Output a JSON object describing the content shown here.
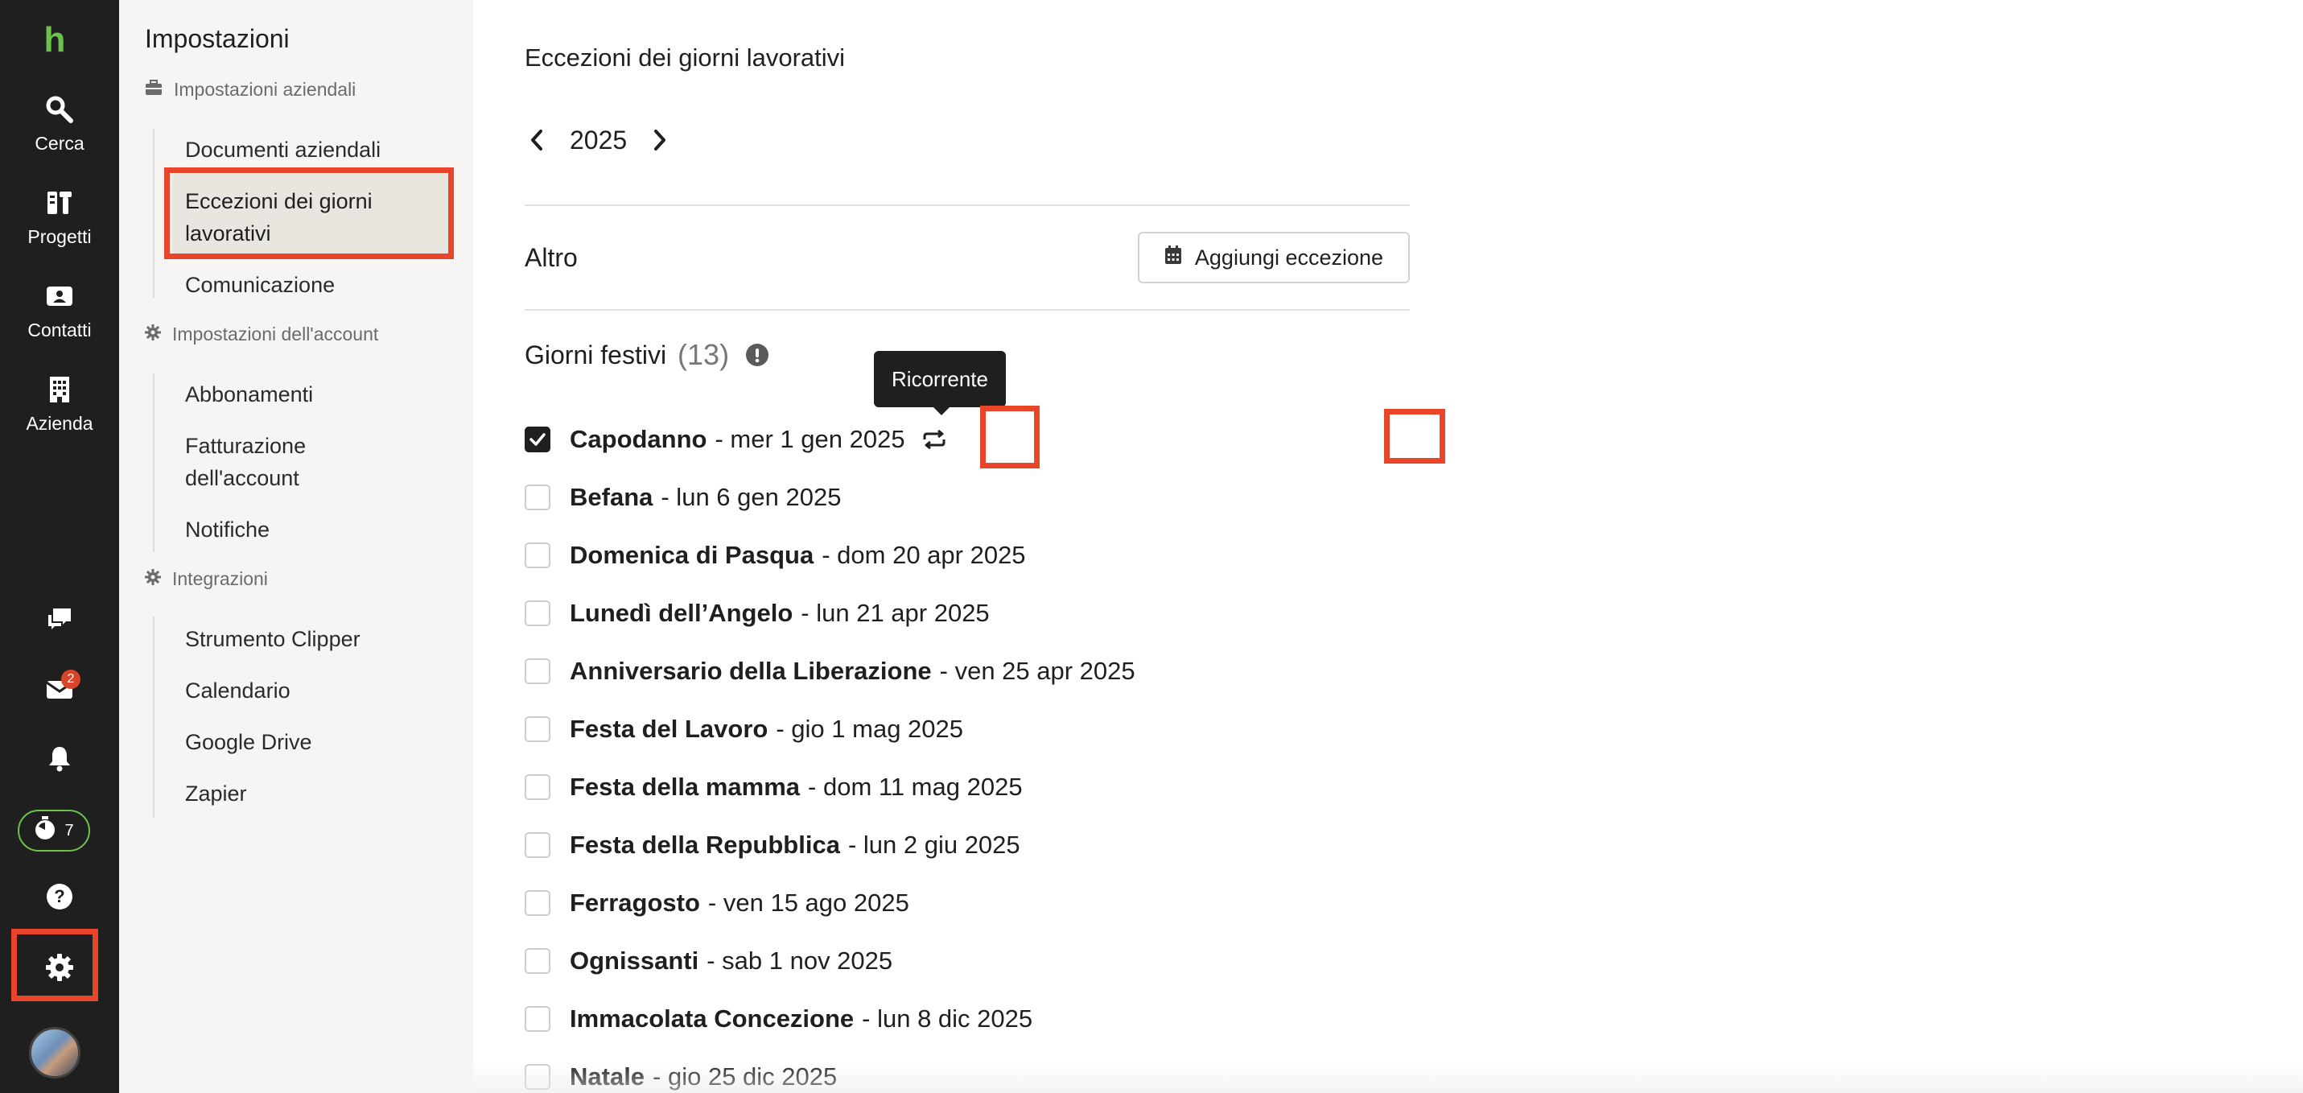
{
  "rail": {
    "logo": "h",
    "items": [
      {
        "label": "Cerca",
        "icon": "search-icon"
      },
      {
        "label": "Progetti",
        "icon": "projects-icon"
      },
      {
        "label": "Contatti",
        "icon": "contacts-icon"
      },
      {
        "label": "Azienda",
        "icon": "building-icon"
      }
    ],
    "inbox_badge": "2",
    "timer_count": "7"
  },
  "sidebar": {
    "title": "Impostazioni",
    "sections": [
      {
        "title": "Impostazioni aziendali",
        "icon": "briefcase-icon",
        "links": [
          "Documenti aziendali",
          "Eccezioni dei giorni lavorativi",
          "Comunicazione"
        ]
      },
      {
        "title": "Impostazioni dell'account",
        "icon": "gear-icon",
        "links": [
          "Abbonamenti",
          "Fatturazione dell'account",
          "Notifiche"
        ]
      },
      {
        "title": "Integrazioni",
        "icon": "gear-icon",
        "links": [
          "Strumento Clipper",
          "Calendario",
          "Google Drive",
          "Zapier"
        ]
      }
    ],
    "active_line1": "Eccezioni dei giorni",
    "active_line2": "lavorativi"
  },
  "main": {
    "title": "Eccezioni dei giorni lavorativi",
    "year": "2025",
    "altro_label": "Altro",
    "add_button": "Aggiungi eccezione",
    "holidays_title": "Giorni festivi",
    "holidays_count": "(13)",
    "tooltip": "Ricorrente",
    "holidays": [
      {
        "name": "Capodanno",
        "date": "- mer 1 gen 2025",
        "checked": true,
        "recurring": true
      },
      {
        "name": "Befana",
        "date": "- lun 6 gen 2025"
      },
      {
        "name": "Domenica di Pasqua",
        "date": "- dom 20 apr 2025"
      },
      {
        "name": "Lunedì dell’Angelo",
        "date": "- lun 21 apr 2025"
      },
      {
        "name": "Anniversario della Liberazione",
        "date": "- ven 25 apr 2025"
      },
      {
        "name": "Festa del Lavoro",
        "date": "- gio 1 mag 2025"
      },
      {
        "name": "Festa della mamma",
        "date": "- dom 11 mag 2025"
      },
      {
        "name": "Festa della Repubblica",
        "date": "- lun 2 giu 2025"
      },
      {
        "name": "Ferragosto",
        "date": "- ven 15 ago 2025"
      },
      {
        "name": "Ognissanti",
        "date": "- sab 1 nov 2025"
      },
      {
        "name": "Immacolata Concezione",
        "date": "- lun 8 dic 2025"
      },
      {
        "name": "Natale",
        "date": "- gio 25 dic 2025"
      }
    ]
  },
  "colors": {
    "rail_bg": "#1f1f1f",
    "brand_green": "#6cc24a",
    "highlight_red": "#e8452b",
    "sidebar_bg": "#f6f5f3"
  }
}
